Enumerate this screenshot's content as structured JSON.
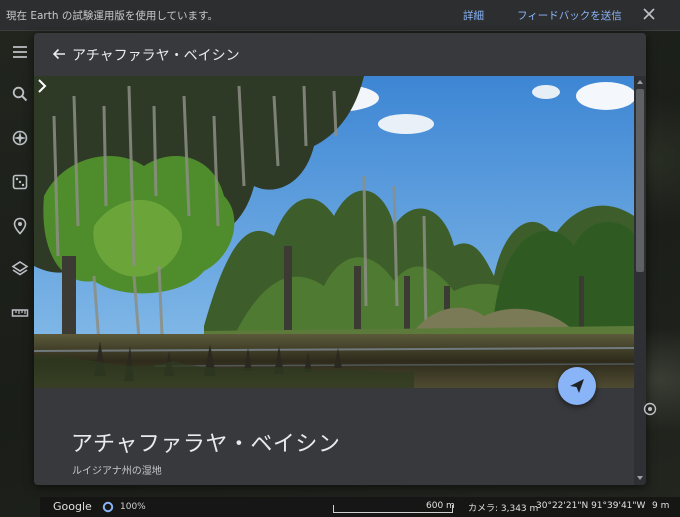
{
  "notice": {
    "text": "現在 Earth の試験運用版を使用しています。",
    "details_link": "詳細",
    "feedback_link": "フィードバックを送信"
  },
  "left_rail": {
    "icons": [
      "menu-icon",
      "search-icon",
      "voyager-icon",
      "random-dice-icon",
      "projects-pin-icon",
      "map-style-layers-icon",
      "measure-ruler-icon"
    ]
  },
  "panel": {
    "header_title": "アチャファラヤ・ベイシン",
    "place_title": "アチャファラヤ・ベイシン",
    "place_subtitle": "ルイジアナ州の湿地"
  },
  "status": {
    "logo": "Google",
    "loading_percent": "100%",
    "scale_label": "600 m",
    "camera": "カメラ: 3,343 m",
    "coordinates": "30°22'21\"N 91°39'41\"W",
    "elevation": "9 m"
  },
  "colors": {
    "accent": "#8ab4f8",
    "panel_bg": "#38393c",
    "notice_bg": "#2d2e30"
  }
}
